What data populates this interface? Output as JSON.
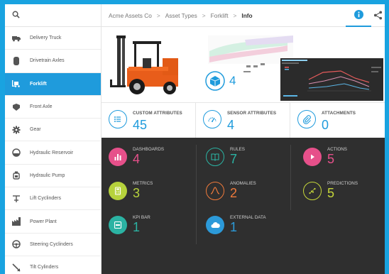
{
  "sidebar": {
    "items": [
      {
        "label": "Delivery Truck",
        "icon": "truck-icon"
      },
      {
        "label": "Drivetrain Axles",
        "icon": "axle-icon"
      },
      {
        "label": "Forklift",
        "icon": "forklift-icon",
        "active": true
      },
      {
        "label": "Front Axle",
        "icon": "front-axle-icon"
      },
      {
        "label": "Gear",
        "icon": "gear-icon"
      },
      {
        "label": "Hydraulic Reservoir",
        "icon": "reservoir-icon"
      },
      {
        "label": "Hydraulic Pump",
        "icon": "pump-icon"
      },
      {
        "label": "Lift Cyclinders",
        "icon": "lift-cylinder-icon"
      },
      {
        "label": "Power Plant",
        "icon": "power-plant-icon"
      },
      {
        "label": "Steering Cyclinders",
        "icon": "steering-icon"
      },
      {
        "label": "Tilt Cylinders",
        "icon": "tilt-icon"
      }
    ]
  },
  "breadcrumb": [
    "Acme Assets Co",
    "Asset Types",
    "Forklift",
    "Info"
  ],
  "hero": {
    "model_count": "4"
  },
  "attributes": [
    {
      "label": "CUSTOM ATTRIBUTES",
      "value": "45"
    },
    {
      "label": "SENSOR ATTRIBUTES",
      "value": "4"
    },
    {
      "label": "ATTACHMENTS",
      "value": "0"
    }
  ],
  "tiles": [
    {
      "label": "DASHBOARDS",
      "value": "4",
      "color": "#e6508a"
    },
    {
      "label": "RULES",
      "value": "7",
      "color": "#2bb3a3"
    },
    {
      "label": "ACTIONS",
      "value": "5",
      "color": "#e6508a"
    },
    {
      "label": "METRICS",
      "value": "3",
      "color": "#b6d23c"
    },
    {
      "label": "ANOMALIES",
      "value": "2",
      "color": "#ef7a3b"
    },
    {
      "label": "PREDICTIONS",
      "value": "5",
      "color": "#c5d63a"
    },
    {
      "label": "KPI BAR",
      "value": "1",
      "color": "#2bb3a3"
    },
    {
      "label": "EXTERNAL DATA",
      "value": "1",
      "color": "#2c9ad9"
    }
  ],
  "colors": {
    "accent": "#1f9bdc",
    "dark_panel": "#2f2f2f",
    "background": "#19a3e0"
  }
}
